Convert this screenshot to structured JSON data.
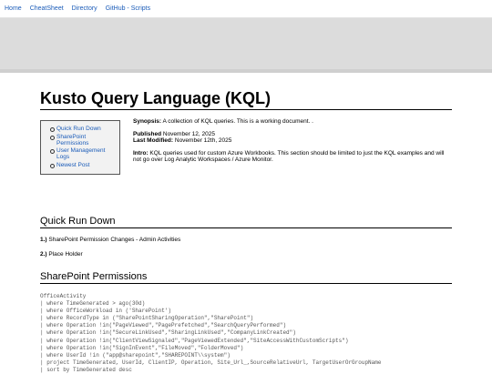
{
  "nav": {
    "items": [
      "Home",
      "CheatSheet",
      "Directory",
      "GitHub - Scripts"
    ]
  },
  "page": {
    "title": "Kusto Query Language (KQL)"
  },
  "toc": {
    "items": [
      "Quick Run Down",
      "SharePoint Permissions",
      "User Management Logs",
      "Newest Post"
    ]
  },
  "info": {
    "synopsis_label": "Synopsis:",
    "synopsis": "A collection of KQL queries. This is a working document. .",
    "published_label": "Published",
    "published": "November 12, 2025",
    "modified_label": "Last Modified:",
    "modified": "November 12th, 2025",
    "intro_label": "Intro:",
    "intro": "KQL queries used for custom Azure Workbooks. This section should be limited to just the KQL examples and will not go over Log Analytic Workspaces / Azure Monitor."
  },
  "quick_run_down": {
    "heading": "Quick Run Down",
    "items": [
      {
        "num": "1.)",
        "text": "SharePoint Permission Changes - Admin Activities"
      },
      {
        "num": "2.)",
        "text": "Place Holder"
      }
    ]
  },
  "sharepoint_permissions": {
    "heading": "SharePoint Permissions",
    "code": [
      "OfficeActivity",
      "| where TimeGenerated > ago(30d)",
      "| where OfficeWorkload in ('SharePoint')",
      "| where RecordType in (\"SharePointSharingOperation\",\"SharePoint\")",
      "| where Operation !in(\"PageViewed\",\"PagePrefetched\",\"SearchQueryPerformed\")",
      "| where Operation !in(\"SecureLinkUsed\",\"SharingLinkUsed\",\"CompanyLinkCreated\")",
      "| where Operation !in(\"ClientViewSignaled\",\"PageViewedExtended\",\"SiteAccessWithCustomScripts\")",
      "| where Operation !in(\"SignInEvent\",\"FileMoved\",\"FolderMoved\")",
      "| where UserId !in (\"app@sharepoint\",\"SHAREPOINT\\\\system\")",
      "| project TimeGenerated, UserId, ClientIP, Operation, Site_Url_,SourceRelativeUrl, TargetUserOrGroupName",
      "| sort by TimeGenerated desc"
    ]
  }
}
